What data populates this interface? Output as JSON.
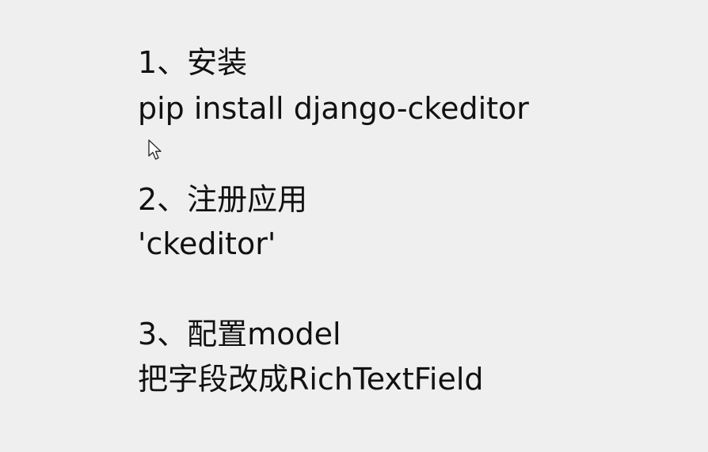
{
  "slide": {
    "step1_heading": "1、安装",
    "step1_detail": "pip install django-ckeditor",
    "step2_heading": "2、注册应用",
    "step2_detail": "'ckeditor'",
    "step3_heading": "3、配置model",
    "step3_detail": "把字段改成RichTextField"
  },
  "icons": {
    "cursor": "mouse-pointer-icon"
  },
  "colors": {
    "background": "#efefef",
    "text": "#111111"
  }
}
